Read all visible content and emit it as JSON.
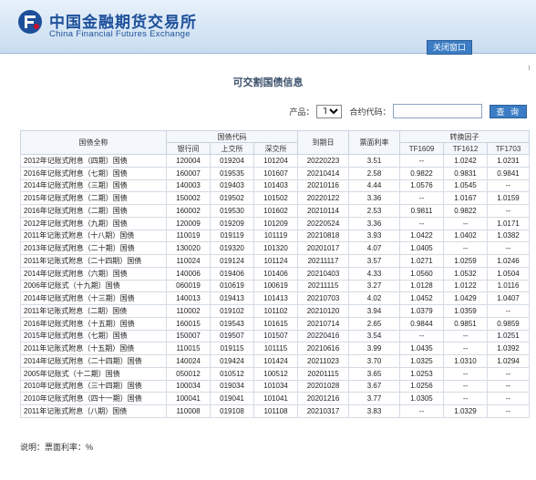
{
  "header": {
    "logo_cn": "中国金融期货交易所",
    "logo_en": "China Financial Futures Exchange",
    "close_label": "关闭窗口"
  },
  "page_title": "可交割国债信息",
  "filter": {
    "product_label": "产品：",
    "product_value": "TF",
    "contract_label": "合约代码：",
    "contract_value": "",
    "query_label": "查 询"
  },
  "table": {
    "headers": {
      "name": "国债全称",
      "code_group": "国债代码",
      "code_ib": "银行间",
      "code_sh": "上交所",
      "code_sz": "深交所",
      "maturity": "到期日",
      "coupon": "票面利率",
      "cf_group": "转换因子",
      "cf1": "TF1609",
      "cf2": "TF1612",
      "cf3": "TF1703"
    },
    "rows": [
      [
        "2012年记账式附息（四期）国债",
        "120004",
        "019204",
        "101204",
        "20220223",
        "3.51",
        "--",
        "1.0242",
        "1.0231"
      ],
      [
        "2016年记账式附息（七期）国债",
        "160007",
        "019535",
        "101607",
        "20210414",
        "2.58",
        "0.9822",
        "0.9831",
        "0.9841"
      ],
      [
        "2014年记账式附息（三期）国债",
        "140003",
        "019403",
        "101403",
        "20210116",
        "4.44",
        "1.0576",
        "1.0545",
        "--"
      ],
      [
        "2015年记账式附息（二期）国债",
        "150002",
        "019502",
        "101502",
        "20220122",
        "3.36",
        "--",
        "1.0167",
        "1.0159"
      ],
      [
        "2016年记账式附息（二期）国债",
        "160002",
        "019530",
        "101602",
        "20210114",
        "2.53",
        "0.9811",
        "0.9822",
        "--"
      ],
      [
        "2012年记账式附息（九期）国债",
        "120009",
        "019209",
        "101209",
        "20220524",
        "3.36",
        "--",
        "--",
        "1.0171"
      ],
      [
        "2011年记账式附息（十八期）国债",
        "110019",
        "019119",
        "101119",
        "20210818",
        "3.93",
        "1.0422",
        "1.0402",
        "1.0382"
      ],
      [
        "2013年记账式附息（二十期）国债",
        "130020",
        "019320",
        "101320",
        "20201017",
        "4.07",
        "1.0405",
        "--",
        "--"
      ],
      [
        "2011年记账式附息（二十四期）国债",
        "110024",
        "019124",
        "101124",
        "20211117",
        "3.57",
        "1.0271",
        "1.0259",
        "1.0246"
      ],
      [
        "2014年记账式附息（六期）国债",
        "140006",
        "019406",
        "101406",
        "20210403",
        "4.33",
        "1.0560",
        "1.0532",
        "1.0504"
      ],
      [
        "2006年记账式（十九期）国债",
        "060019",
        "010619",
        "100619",
        "20211115",
        "3.27",
        "1.0128",
        "1.0122",
        "1.0116"
      ],
      [
        "2014年记账式附息（十三期）国债",
        "140013",
        "019413",
        "101413",
        "20210703",
        "4.02",
        "1.0452",
        "1.0429",
        "1.0407"
      ],
      [
        "2011年记账式附息（二期）国债",
        "110002",
        "019102",
        "101102",
        "20210120",
        "3.94",
        "1.0379",
        "1.0359",
        "--"
      ],
      [
        "2016年记账式附息（十五期）国债",
        "160015",
        "019543",
        "101615",
        "20210714",
        "2.65",
        "0.9844",
        "0.9851",
        "0.9859"
      ],
      [
        "2015年记账式附息（七期）国债",
        "150007",
        "019507",
        "101507",
        "20220416",
        "3.54",
        "--",
        "--",
        "1.0251"
      ],
      [
        "2011年记账式附息（十五期）国债",
        "110015",
        "019115",
        "101115",
        "20210616",
        "3.99",
        "1.0435",
        "--",
        "1.0392"
      ],
      [
        "2014年记账式附息（二十四期）国债",
        "140024",
        "019424",
        "101424",
        "20211023",
        "3.70",
        "1.0325",
        "1.0310",
        "1.0294"
      ],
      [
        "2005年记账式（十二期）国债",
        "050012",
        "010512",
        "100512",
        "20201115",
        "3.65",
        "1.0253",
        "--",
        "--"
      ],
      [
        "2010年记账式附息（三十四期）国债",
        "100034",
        "019034",
        "101034",
        "20201028",
        "3.67",
        "1.0256",
        "--",
        "--"
      ],
      [
        "2010年记账式附息（四十一期）国债",
        "100041",
        "019041",
        "101041",
        "20201216",
        "3.77",
        "1.0305",
        "--",
        "--"
      ],
      [
        "2011年记账式附息（八期）国债",
        "110008",
        "019108",
        "101108",
        "20210317",
        "3.83",
        "--",
        "1.0329",
        "--"
      ]
    ]
  },
  "note": "说明：票面利率：%"
}
